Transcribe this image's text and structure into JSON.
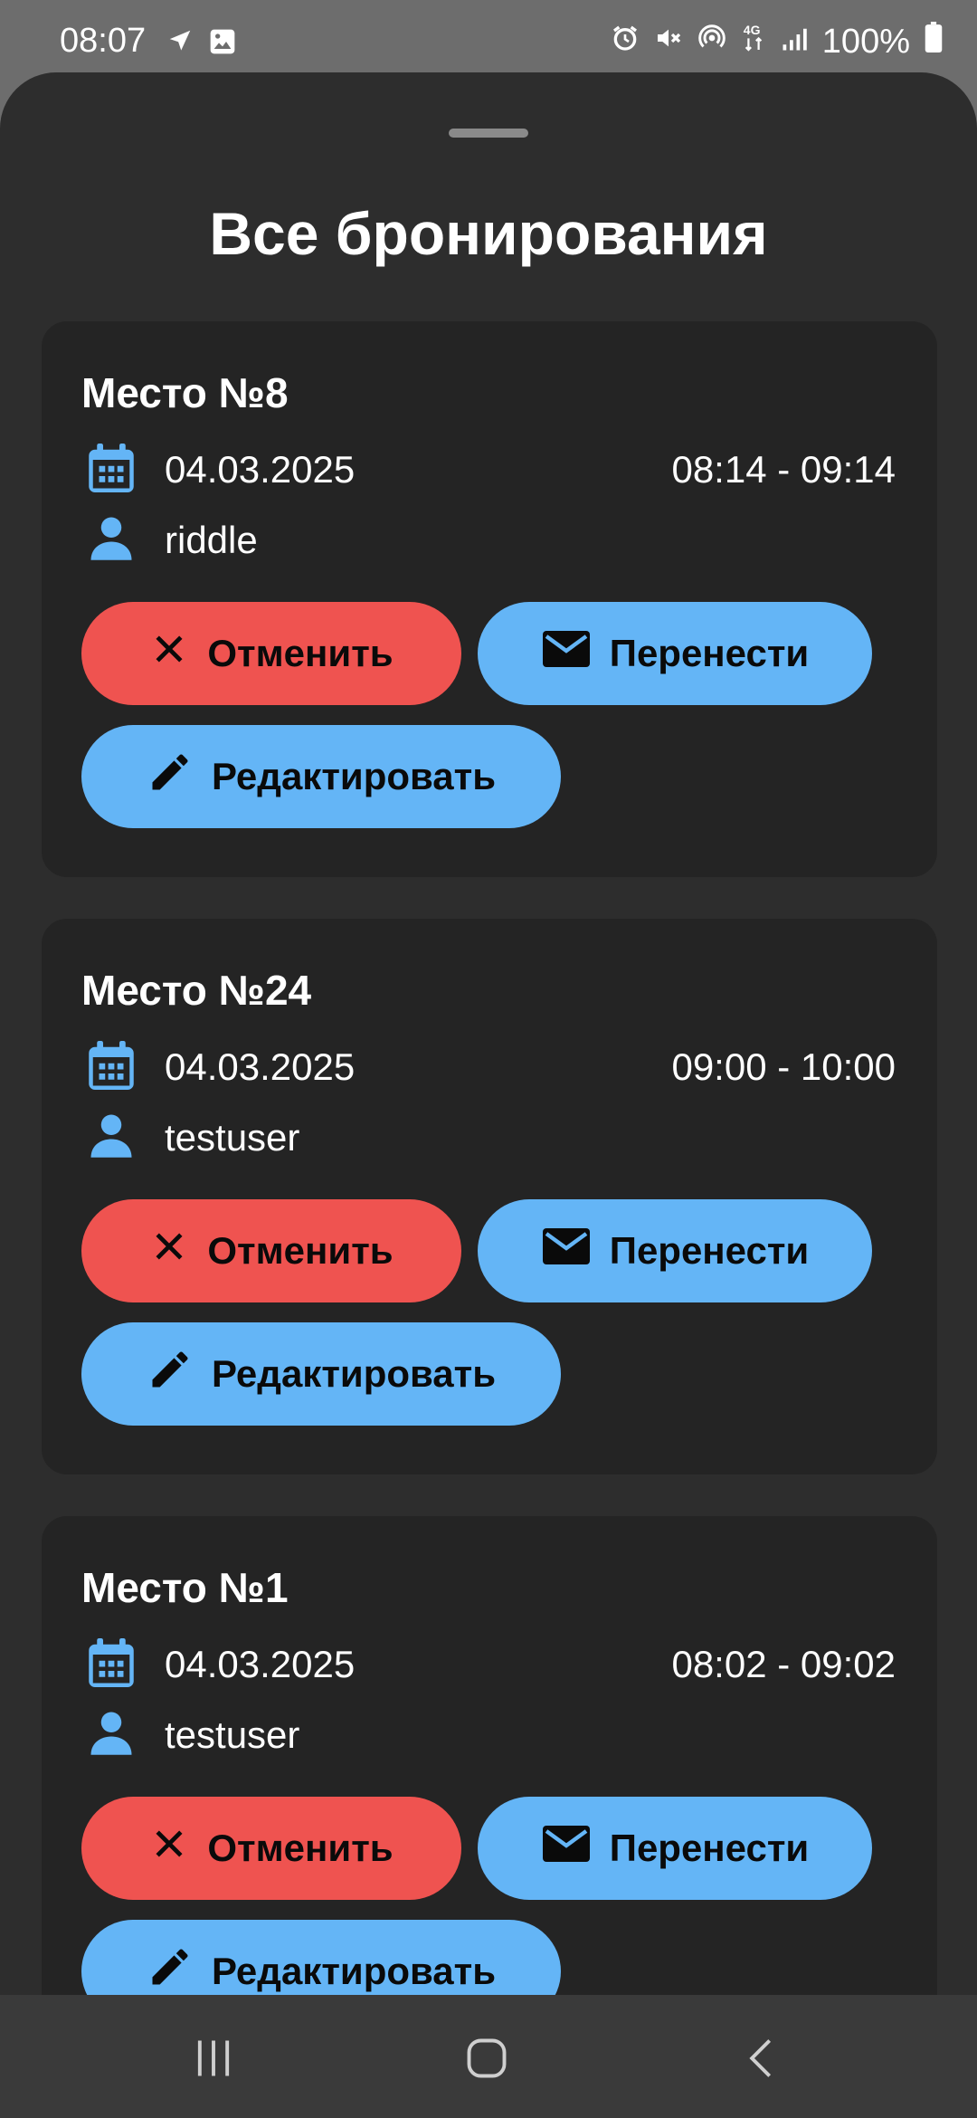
{
  "status_bar": {
    "time": "08:07",
    "battery": "100%",
    "icons": [
      "navigation-icon",
      "image-icon",
      "alarm-icon",
      "mute-icon",
      "hotspot-icon",
      "4g-icon",
      "signal-icon",
      "battery-icon"
    ]
  },
  "sheet": {
    "title": "Все бронирования"
  },
  "bookings": [
    {
      "place": "Место №8",
      "date": "04.03.2025",
      "time": "08:14 - 09:14",
      "user": "riddle"
    },
    {
      "place": "Место №24",
      "date": "04.03.2025",
      "time": "09:00 - 10:00",
      "user": "testuser"
    },
    {
      "place": "Место №1",
      "date": "04.03.2025",
      "time": "08:02 - 09:02",
      "user": "testuser"
    }
  ],
  "actions": {
    "cancel_label": "Отменить",
    "move_label": "Перенести",
    "edit_label": "Редактировать"
  },
  "colors": {
    "cancel": "#ef5350",
    "primary": "#64b5f6",
    "card": "#242424",
    "sheet": "#2d2d2d"
  },
  "nav_bar": {
    "icons": [
      "recent-apps-icon",
      "home-icon",
      "back-icon"
    ]
  }
}
